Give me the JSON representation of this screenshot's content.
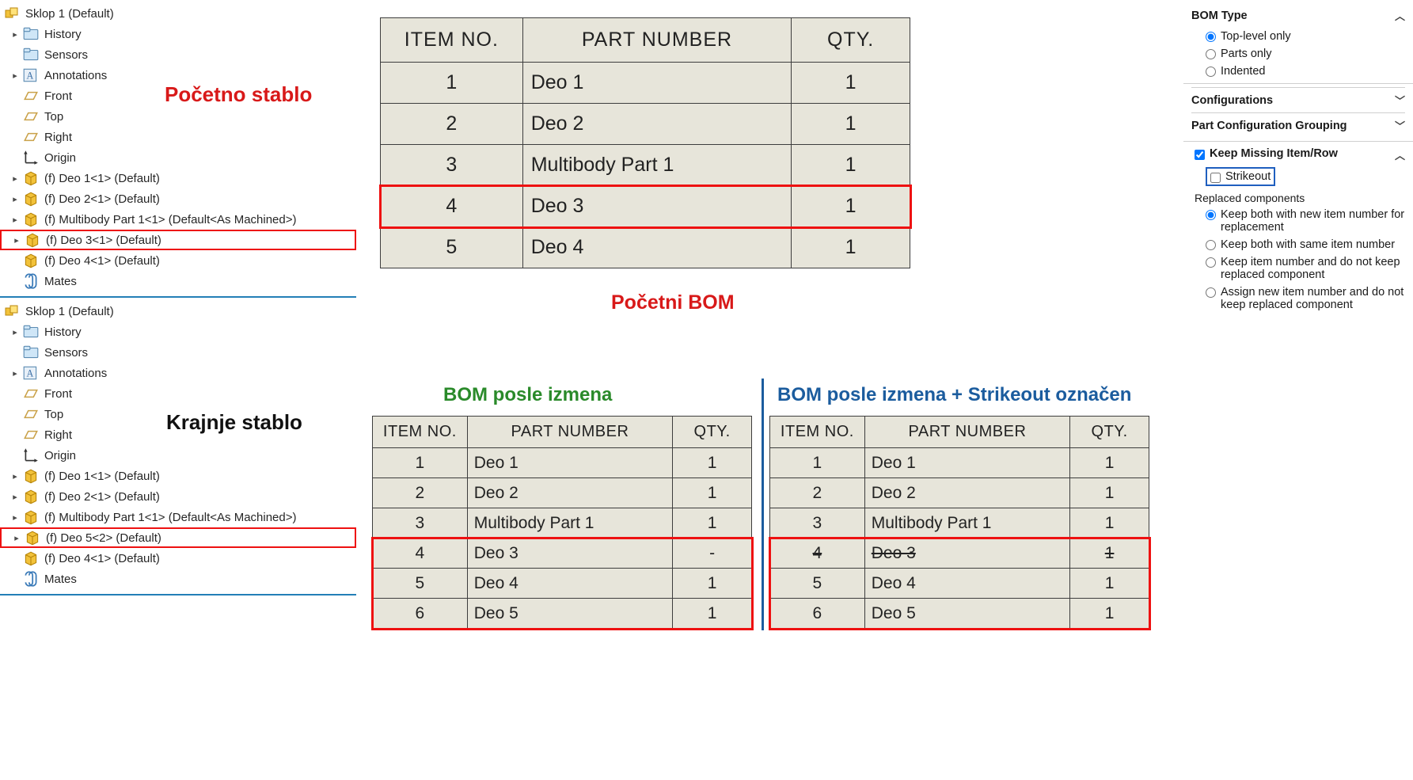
{
  "tree1": {
    "title": "Sklop 1  (Default)",
    "overlay": "Početno stablo",
    "items": [
      {
        "label": "History",
        "icon": "folder",
        "expand": true
      },
      {
        "label": "Sensors",
        "icon": "folder",
        "expand": false
      },
      {
        "label": "Annotations",
        "icon": "anno",
        "expand": true
      },
      {
        "label": "Front",
        "icon": "plane",
        "expand": false
      },
      {
        "label": "Top",
        "icon": "plane",
        "expand": false
      },
      {
        "label": "Right",
        "icon": "plane",
        "expand": false
      },
      {
        "label": "Origin",
        "icon": "origin",
        "expand": false
      },
      {
        "label": "(f) Deo 1<1> (Default)",
        "icon": "part",
        "expand": true
      },
      {
        "label": "(f) Deo 2<1> (Default)",
        "icon": "part",
        "expand": true
      },
      {
        "label": "(f) Multibody Part 1<1> (Default<As Machined>)",
        "icon": "part",
        "expand": true
      },
      {
        "label": "(f) Deo 3<1> (Default)",
        "icon": "part",
        "expand": true,
        "hl": true
      },
      {
        "label": "(f) Deo 4<1> (Default)",
        "icon": "part",
        "expand": false
      },
      {
        "label": "Mates",
        "icon": "mates",
        "expand": false
      }
    ]
  },
  "tree2": {
    "title": "Sklop 1  (Default)",
    "overlay": "Krajnje stablo",
    "items": [
      {
        "label": "History",
        "icon": "folder",
        "expand": true
      },
      {
        "label": "Sensors",
        "icon": "folder",
        "expand": false
      },
      {
        "label": "Annotations",
        "icon": "anno",
        "expand": true
      },
      {
        "label": "Front",
        "icon": "plane",
        "expand": false
      },
      {
        "label": "Top",
        "icon": "plane",
        "expand": false
      },
      {
        "label": "Right",
        "icon": "plane",
        "expand": false
      },
      {
        "label": "Origin",
        "icon": "origin",
        "expand": false
      },
      {
        "label": "(f) Deo 1<1> (Default)",
        "icon": "part",
        "expand": true
      },
      {
        "label": "(f) Deo 2<1> (Default)",
        "icon": "part",
        "expand": true
      },
      {
        "label": "(f) Multibody Part 1<1> (Default<As Machined>)",
        "icon": "part",
        "expand": true
      },
      {
        "label": "(f) Deo 5<2> (Default)",
        "icon": "part",
        "expand": true,
        "hl": true
      },
      {
        "label": "(f) Deo 4<1> (Default)",
        "icon": "part",
        "expand": false
      },
      {
        "label": "Mates",
        "icon": "mates",
        "expand": false
      }
    ]
  },
  "bom_main": {
    "caption": "Početni BOM",
    "cols": [
      "ITEM NO.",
      "PART NUMBER",
      "QTY."
    ],
    "rows": [
      {
        "n": "1",
        "p": "Deo 1",
        "q": "1"
      },
      {
        "n": "2",
        "p": "Deo 2",
        "q": "1"
      },
      {
        "n": "3",
        "p": "Multibody Part 1",
        "q": "1"
      },
      {
        "n": "4",
        "p": "Deo 3",
        "q": "1",
        "hl": true
      },
      {
        "n": "5",
        "p": "Deo 4",
        "q": "1"
      }
    ]
  },
  "bom_left": {
    "caption": "BOM posle izmena",
    "cols": [
      "ITEM NO.",
      "PART NUMBER",
      "QTY."
    ],
    "rows": [
      {
        "n": "1",
        "p": "Deo 1",
        "q": "1"
      },
      {
        "n": "2",
        "p": "Deo 2",
        "q": "1"
      },
      {
        "n": "3",
        "p": "Multibody Part 1",
        "q": "1"
      },
      {
        "n": "4",
        "p": "Deo 3",
        "q": "-"
      },
      {
        "n": "5",
        "p": "Deo 4",
        "q": "1"
      },
      {
        "n": "6",
        "p": "Deo 5",
        "q": "1"
      }
    ],
    "hl_from": 3,
    "hl_to": 5
  },
  "bom_right": {
    "caption": "BOM posle izmena + Strikeout označen",
    "cols": [
      "ITEM NO.",
      "PART NUMBER",
      "QTY."
    ],
    "rows": [
      {
        "n": "1",
        "p": "Deo 1",
        "q": "1"
      },
      {
        "n": "2",
        "p": "Deo 2",
        "q": "1"
      },
      {
        "n": "3",
        "p": "Multibody Part 1",
        "q": "1"
      },
      {
        "n": "4",
        "p": "Deo 3",
        "q": "1",
        "strike": true
      },
      {
        "n": "5",
        "p": "Deo 4",
        "q": "1"
      },
      {
        "n": "6",
        "p": "Deo 5",
        "q": "1"
      }
    ],
    "hl_from": 3,
    "hl_to": 5
  },
  "panel": {
    "bom_type": {
      "head": "BOM Type",
      "options": [
        {
          "label": "Top-level only",
          "sel": true
        },
        {
          "label": "Parts only",
          "sel": false
        },
        {
          "label": "Indented",
          "sel": false
        }
      ]
    },
    "configurations": "Configurations",
    "pcg": "Part Configuration Grouping",
    "keep": {
      "head": "Keep Missing Item/Row",
      "checked": true
    },
    "strikeout": "Strikeout",
    "replaced": {
      "head": "Replaced components",
      "options": [
        {
          "label": "Keep both with new item number for replacement",
          "sel": true
        },
        {
          "label": "Keep both with same item number",
          "sel": false
        },
        {
          "label": "Keep item number and do not keep replaced component",
          "sel": false
        },
        {
          "label": "Assign new item number and do not keep replaced component",
          "sel": false
        }
      ]
    }
  }
}
